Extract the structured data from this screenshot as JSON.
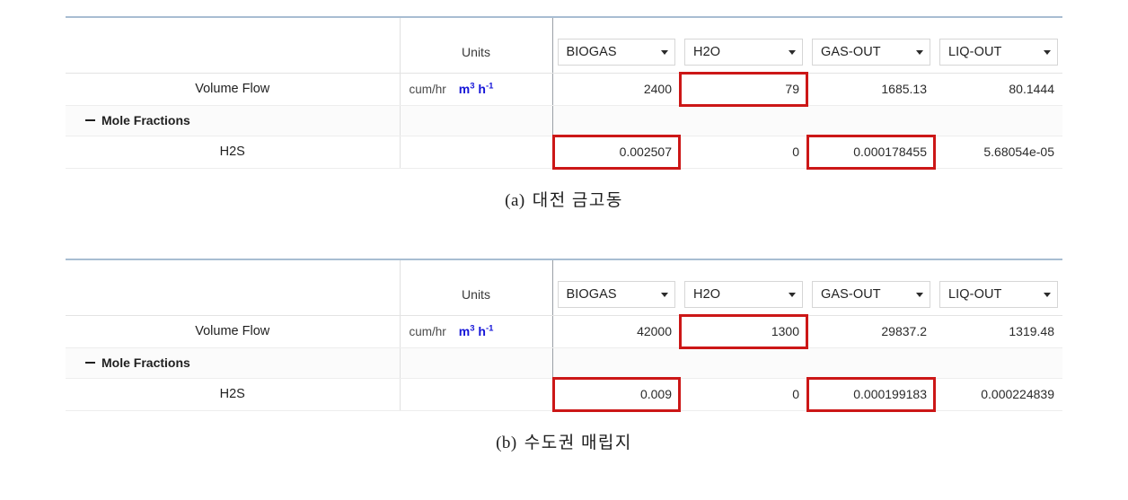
{
  "figures": [
    {
      "id": "a",
      "caption_index": "(a)",
      "caption_text": "대전 금고동",
      "table": {
        "units_header": "Units",
        "stream_columns": [
          {
            "label": "BIOGAS"
          },
          {
            "label": "H2O"
          },
          {
            "label": "GAS-OUT"
          },
          {
            "label": "LIQ-OUT"
          }
        ],
        "rows": [
          {
            "label": "Volume Flow",
            "units_text": "cum/hr",
            "units_si_base": "m",
            "units_si_sup1": "3",
            "units_si_base2": "h",
            "units_si_sup2": "-1",
            "values": [
              "2400",
              "79",
              "1685.13",
              "80.1444"
            ],
            "marked": [
              false,
              true,
              false,
              false
            ]
          },
          {
            "label": "Mole Fractions",
            "group": true,
            "units_text": "",
            "values": [
              "",
              "",
              "",
              ""
            ],
            "marked": [
              false,
              false,
              false,
              false
            ]
          },
          {
            "label": "H2S",
            "units_text": "",
            "values": [
              "0.002507",
              "0",
              "0.000178455",
              "5.68054e-05"
            ],
            "marked": [
              true,
              false,
              true,
              false
            ]
          }
        ]
      }
    },
    {
      "id": "b",
      "caption_index": "(b)",
      "caption_text": "수도권 매립지",
      "table": {
        "units_header": "Units",
        "stream_columns": [
          {
            "label": "BIOGAS"
          },
          {
            "label": "H2O"
          },
          {
            "label": "GAS-OUT"
          },
          {
            "label": "LIQ-OUT"
          }
        ],
        "rows": [
          {
            "label": "Volume Flow",
            "units_text": "cum/hr",
            "units_si_base": "m",
            "units_si_sup1": "3",
            "units_si_base2": "h",
            "units_si_sup2": "-1",
            "values": [
              "42000",
              "1300",
              "29837.2",
              "1319.48"
            ],
            "marked": [
              false,
              true,
              false,
              false
            ]
          },
          {
            "label": "Mole Fractions",
            "group": true,
            "units_text": "",
            "values": [
              "",
              "",
              "",
              ""
            ],
            "marked": [
              false,
              false,
              false,
              false
            ]
          },
          {
            "label": "H2S",
            "units_text": "",
            "values": [
              "0.009",
              "0",
              "0.000199183",
              "0.000224839"
            ],
            "marked": [
              true,
              false,
              true,
              false
            ]
          }
        ]
      }
    }
  ],
  "colors": {
    "mark": "#cc1717",
    "si_units": "#1515d8",
    "table_top_rule": "#a8bdd2"
  },
  "icons": {
    "dropdown": "chevron-down-icon",
    "collapse": "minus-collapse-icon"
  }
}
